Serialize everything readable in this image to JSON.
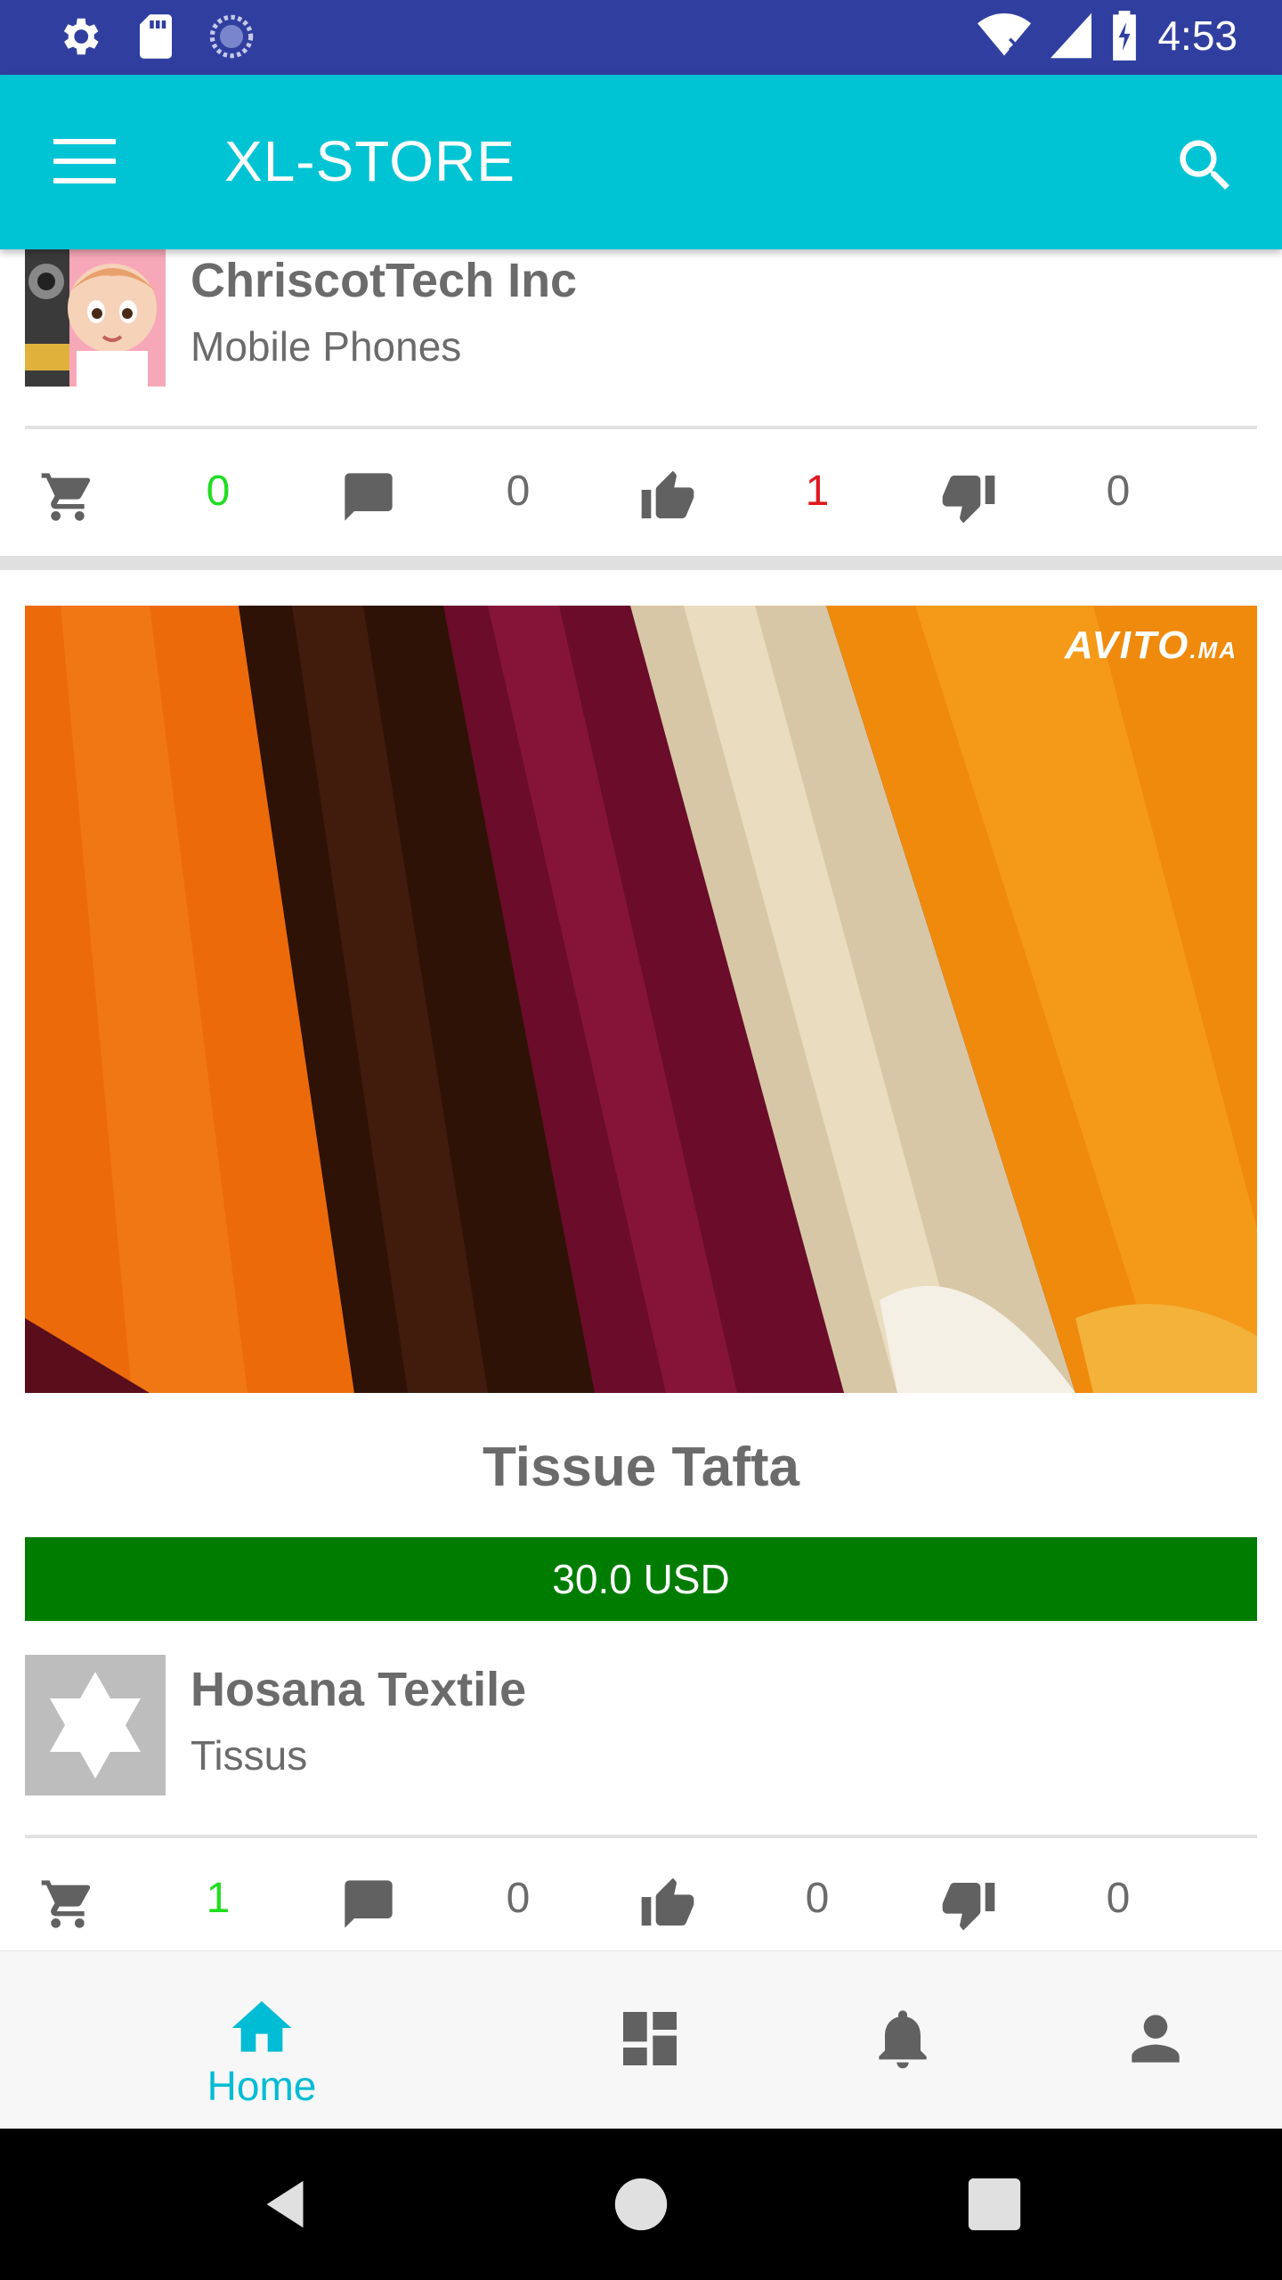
{
  "status_bar": {
    "time": "4:53",
    "icons": [
      "settings-icon",
      "sd-card-icon",
      "sync-icon",
      "wifi-icon",
      "signal-icon",
      "battery-charging-icon"
    ]
  },
  "app_bar": {
    "title": "XL-STORE",
    "menu_icon": "menu-icon",
    "search_icon": "search-icon"
  },
  "listing_1": {
    "seller_name": "ChriscotTech Inc",
    "seller_category": "Mobile Phones",
    "cart_count": "0",
    "comment_count": "0",
    "like_count": "1",
    "dislike_count": "0"
  },
  "listing_2": {
    "image_watermark": "AVITO",
    "image_watermark_suffix": ".MA",
    "product_title": "Tissue Tafta",
    "price": "30.0 USD",
    "seller_name": "Hosana Textile",
    "seller_category": "Tissus",
    "cart_count": "1",
    "comment_count": "0",
    "like_count": "0",
    "dislike_count": "0"
  },
  "bottom_nav": {
    "items": [
      {
        "label": "Home",
        "icon": "home-icon",
        "active": true
      },
      {
        "label": "",
        "icon": "dashboard-icon",
        "active": false
      },
      {
        "label": "",
        "icon": "bell-icon",
        "active": false
      },
      {
        "label": "",
        "icon": "person-icon",
        "active": false
      }
    ]
  },
  "colors": {
    "status_bar": "#303f9f",
    "app_bar": "#00c4d4",
    "accent": "#00bcd4",
    "price_bg": "#007d00",
    "count_green": "#22dd22",
    "count_red": "#e0191e",
    "text_gray": "#6b6b6b"
  }
}
